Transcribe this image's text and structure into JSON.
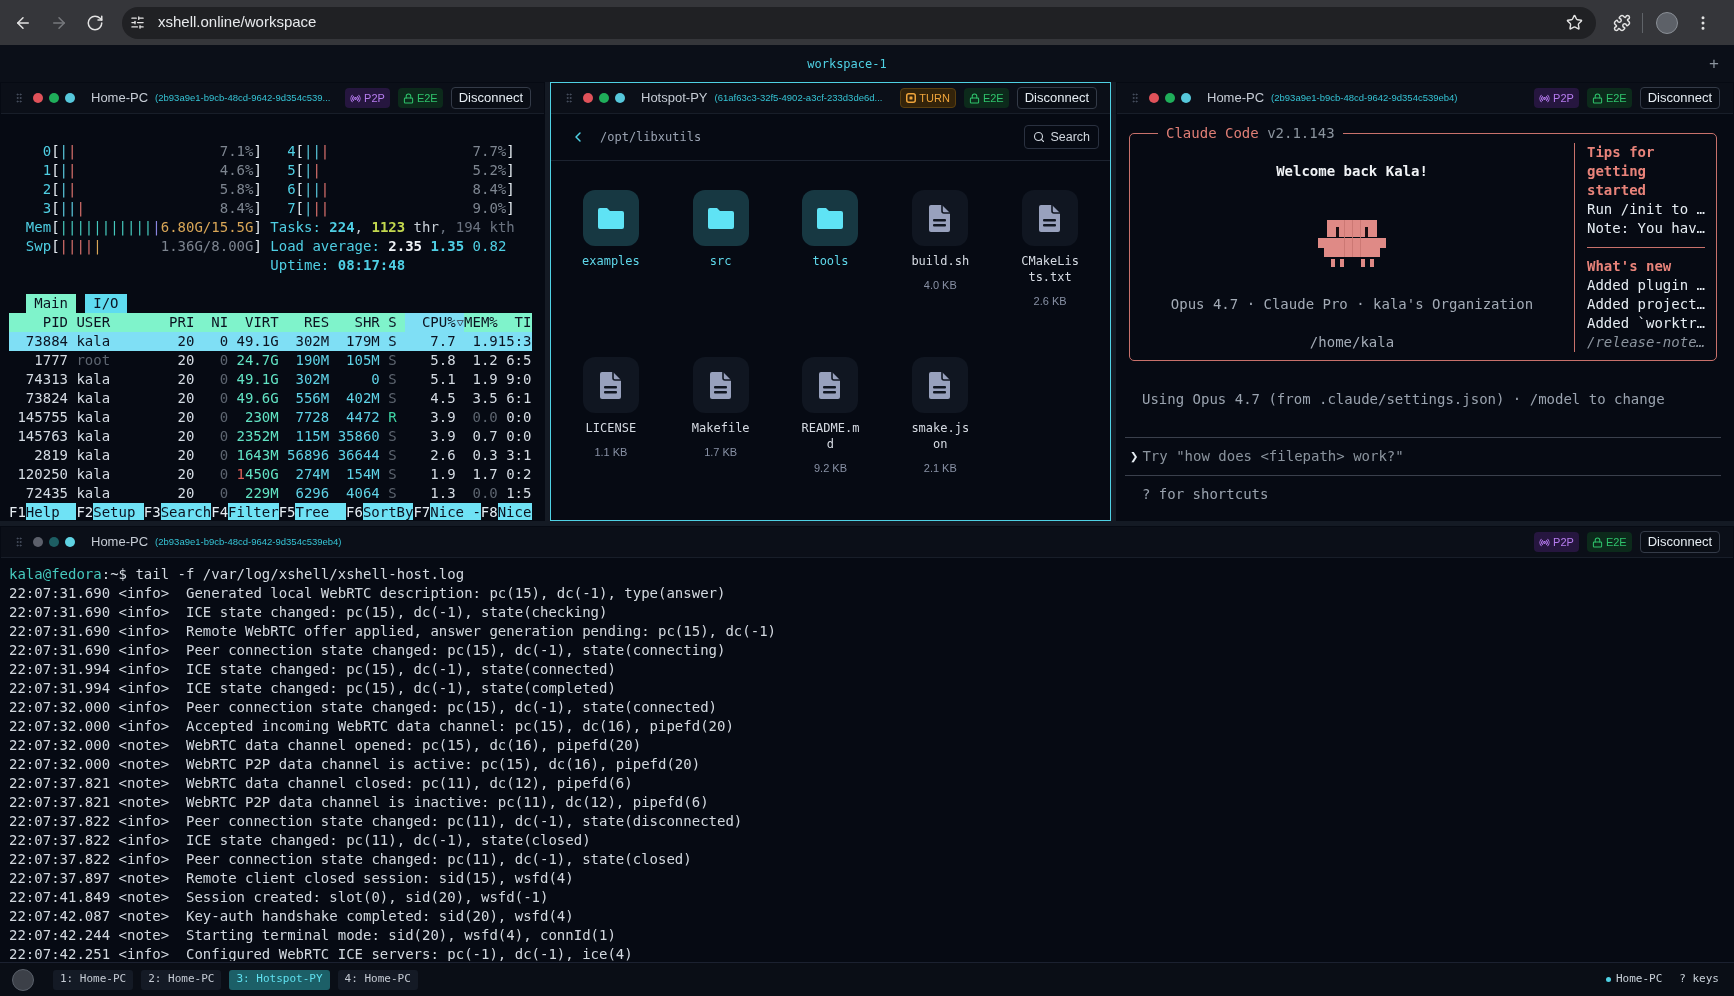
{
  "browser": {
    "nav": [
      {
        "kind": "back",
        "disabled": false
      },
      {
        "kind": "forward",
        "disabled": true
      },
      {
        "kind": "reload",
        "disabled": false
      }
    ],
    "url": "xshell.online/workspace"
  },
  "workspace": {
    "title": "workspace-1",
    "add": "+"
  },
  "panes": [
    {
      "kind": "htop",
      "host": "Home-PC",
      "session": "(2b93a9e1-b9cb-48cd-9642-9d354c539...",
      "focused": false,
      "dots": [
        {
          "color": "#e0525a"
        },
        {
          "color": "#1fae5a"
        },
        {
          "color": "#56c8dc"
        }
      ],
      "badges": [
        {
          "kind": "p2p",
          "label": "P2P"
        },
        {
          "kind": "e2e",
          "label": "E2E"
        }
      ],
      "action": "Disconnect",
      "htop": {
        "cpus": [
          {
            "label": "0",
            "open": "[",
            "bars": [
              {
                "kind": "user",
                "text": "|"
              },
              {
                "kind": "system",
                "text": "|"
              }
            ],
            "reading": "7.1%",
            "close": "]"
          },
          {
            "label": "1",
            "open": "[",
            "bars": [
              {
                "kind": "user",
                "text": "|"
              },
              {
                "kind": "system",
                "text": "|"
              }
            ],
            "reading": "4.6%",
            "close": "]"
          },
          {
            "label": "2",
            "open": "[",
            "bars": [
              {
                "kind": "user",
                "text": "|"
              },
              {
                "kind": "system",
                "text": "|"
              }
            ],
            "reading": "5.8%",
            "close": "]"
          },
          {
            "label": "3",
            "open": "[",
            "bars": [
              {
                "kind": "user",
                "text": "||"
              },
              {
                "kind": "system",
                "text": "|"
              }
            ],
            "reading": "8.4%",
            "close": "]"
          },
          {
            "label": "4",
            "open": "[",
            "bars": [
              {
                "kind": "user",
                "text": "||"
              },
              {
                "kind": "system",
                "text": "|"
              }
            ],
            "reading": "7.7%",
            "close": "]"
          },
          {
            "label": "5",
            "open": "[",
            "bars": [
              {
                "kind": "user",
                "text": "|"
              },
              {
                "kind": "system",
                "text": "|"
              }
            ],
            "reading": "5.2%",
            "close": "]"
          },
          {
            "label": "6",
            "open": "[",
            "bars": [
              {
                "kind": "user",
                "text": "||"
              },
              {
                "kind": "system",
                "text": "|"
              }
            ],
            "reading": "8.4%",
            "close": "]"
          },
          {
            "label": "7",
            "open": "[",
            "bars": [
              {
                "kind": "user",
                "text": "|"
              },
              {
                "kind": "system",
                "text": "||"
              }
            ],
            "reading": "9.0%",
            "close": "]"
          }
        ],
        "memory": {
          "label": "Mem",
          "open": "[",
          "bars": [
            {
              "kind": "used",
              "text": "|||||||||||"
            },
            {
              "kind": "buffers",
              "text": "|"
            }
          ],
          "reading": "6.80G/15.5G",
          "close": "]"
        },
        "swap": {
          "label": "Swp",
          "open": "[",
          "bars": [
            {
              "kind": "system",
              "text": "||||"
            },
            {
              "kind": "cache",
              "text": "|"
            }
          ],
          "reading": "1.36G/8.00G",
          "close": "]"
        },
        "summary": [
          [
            {
              "kind": "label",
              "text": "Tasks: "
            },
            {
              "kind": "value",
              "text": "224"
            },
            {
              "kind": "plain",
              "text": ", "
            },
            {
              "kind": "count",
              "text": "1123"
            },
            {
              "kind": "unit",
              "text": " thr"
            },
            {
              "kind": "dim",
              "text": ", 194 kth"
            }
          ],
          [
            {
              "kind": "label",
              "text": "Load average: "
            },
            {
              "kind": "strong",
              "text": "2.35"
            },
            {
              "kind": "value",
              "text": " 1.35"
            },
            {
              "kind": "label",
              "text": " 0.82"
            }
          ],
          [
            {
              "kind": "label",
              "text": "Uptime: "
            },
            {
              "kind": "value",
              "text": "08:17:48"
            }
          ]
        ],
        "tabs": [
          {
            "label": "Main",
            "selected": true
          },
          {
            "label": "I/O",
            "selected": false
          }
        ],
        "columns": [
          {
            "label": "PID",
            "sorted": false
          },
          {
            "label": "USER",
            "sorted": false
          },
          {
            "label": "PRI",
            "sorted": false
          },
          {
            "label": "NI",
            "sorted": false
          },
          {
            "label": "VIRT",
            "sorted": false
          },
          {
            "label": "RES",
            "sorted": false
          },
          {
            "label": "SHR",
            "sorted": false
          },
          {
            "label": "S",
            "sorted": false
          },
          {
            "label": "CPU%",
            "sorted": true
          },
          {
            "label": "MEM%",
            "sorted": false
          },
          {
            "label": "TI",
            "sorted": false
          }
        ],
        "rows": [
          {
            "selected": true,
            "cells": [
              "73884",
              "kala",
              "20",
              "0",
              "49.1G",
              "302M",
              "179M",
              "S",
              "7.7",
              "1.9",
              "15:3"
            ]
          },
          {
            "selected": false,
            "cells": [
              "1777",
              {
                "text": "root",
                "kind": "dim"
              },
              "20",
              "0",
              "24.7G",
              "190M",
              "105M",
              "S",
              "5.8",
              "1.2",
              "6:5"
            ]
          },
          {
            "selected": false,
            "cells": [
              "74313",
              "kala",
              "20",
              "0",
              "49.1G",
              "302M",
              "0",
              "S",
              "5.1",
              "1.9",
              "9:0"
            ]
          },
          {
            "selected": false,
            "cells": [
              "73824",
              "kala",
              "20",
              "0",
              "49.6G",
              "556M",
              "402M",
              "S",
              "4.5",
              "3.5",
              "6:1"
            ]
          },
          {
            "selected": false,
            "cells": [
              "145755",
              "kala",
              "20",
              "0",
              "230M",
              "7728",
              "4472",
              {
                "text": "R",
                "kind": "running"
              },
              "3.9",
              {
                "text": "0.0",
                "kind": "dim"
              },
              "0:0"
            ]
          },
          {
            "selected": false,
            "cells": [
              "145763",
              "kala",
              "20",
              "0",
              "2352M",
              "115M",
              "35860",
              "S",
              "3.9",
              "0.7",
              "0:0"
            ]
          },
          {
            "selected": false,
            "cells": [
              "2819",
              "kala",
              "20",
              "0",
              "1643M",
              "56896",
              "36644",
              "S",
              "2.6",
              "0.3",
              "3:1"
            ]
          },
          {
            "selected": false,
            "cells": [
              "120250",
              "kala",
              "20",
              "0",
              {
                "lead": "1",
                "text": "450G"
              },
              "274M",
              "154M",
              "S",
              "1.9",
              "1.7",
              "0:2"
            ]
          },
          {
            "selected": false,
            "cells": [
              "72435",
              "kala",
              "20",
              "0",
              "229M",
              "6296",
              "4064",
              "S",
              "1.3",
              {
                "text": "0.0",
                "kind": "dim"
              },
              "1:5"
            ]
          }
        ],
        "keys": [
          {
            "key": "F1",
            "label": "Help"
          },
          {
            "key": "F2",
            "label": "Setup"
          },
          {
            "key": "F3",
            "label": "Search"
          },
          {
            "key": "F4",
            "label": "Filter"
          },
          {
            "key": "F5",
            "label": "Tree"
          },
          {
            "key": "F6",
            "label": "SortBy"
          },
          {
            "key": "F7",
            "label": "Nice -"
          },
          {
            "key": "F8",
            "label": "Nice"
          }
        ]
      }
    },
    {
      "kind": "files",
      "host": "Hotspot-PY",
      "session": "(61af63c3-32f5-4902-a3cf-233d3de6d...",
      "focused": true,
      "dots": [
        {
          "color": "#e0525a"
        },
        {
          "color": "#1fae5a"
        },
        {
          "color": "#56c8dc"
        }
      ],
      "badges": [
        {
          "kind": "turn",
          "label": "TURN"
        },
        {
          "kind": "e2e",
          "label": "E2E"
        }
      ],
      "action": "Disconnect",
      "files": {
        "path": "/opt/libxutils",
        "search": "Search",
        "items": [
          {
            "kind": "folder",
            "name": "examples"
          },
          {
            "kind": "folder",
            "name": "src"
          },
          {
            "kind": "folder",
            "name": "tools"
          },
          {
            "kind": "file",
            "name": "build.sh",
            "size": "4.0 KB"
          },
          {
            "kind": "file",
            "name": "CMakeLists.txt",
            "size": "2.6 KB"
          },
          {
            "kind": "file",
            "name": "LICENSE",
            "size": "1.1 KB"
          },
          {
            "kind": "file",
            "name": "Makefile",
            "size": "1.7 KB"
          },
          {
            "kind": "file",
            "name": "README.md",
            "size": "9.2 KB"
          },
          {
            "kind": "file",
            "name": "smake.json",
            "size": "2.1 KB"
          }
        ]
      }
    },
    {
      "kind": "claude",
      "host": "Home-PC",
      "session": "(2b93a9e1-b9cb-48cd-9642-9d354c539eb4)",
      "focused": false,
      "dots": [
        {
          "color": "#e0525a"
        },
        {
          "color": "#1fae5a"
        },
        {
          "color": "#56c8dc"
        }
      ],
      "badges": [
        {
          "kind": "p2p",
          "label": "P2P"
        },
        {
          "kind": "e2e",
          "label": "E2E"
        }
      ],
      "action": "Disconnect",
      "claude": {
        "title": "Claude Code",
        "version": "v2.1.143",
        "welcome": "Welcome back Kala!",
        "plan": "Opus 4.7 · Claude Pro · kala's Organization",
        "cwd": "/home/kala",
        "sections": [
          {
            "heading": "Tips for getting started",
            "lines": [
              {
                "kind": "item",
                "text": "Run /init to …"
              },
              {
                "kind": "item",
                "text": "Note: You hav…"
              }
            ]
          },
          {
            "heading": "What's new",
            "lines": [
              {
                "kind": "item",
                "text": "Added plugin …"
              },
              {
                "kind": "item",
                "text": "Added project…"
              },
              {
                "kind": "item",
                "text": "Added `worktr…"
              },
              {
                "kind": "link",
                "text": "/release-note…"
              }
            ]
          }
        ],
        "model_note": "Using Opus 4.7 (from .claude/settings.json) · /model to change",
        "prompt": {
          "caret": "❯",
          "placeholder": "Try \"how does <filepath> work?\""
        },
        "hint": "? for shortcuts"
      }
    },
    {
      "kind": "log",
      "host": "Home-PC",
      "session": "(2b93a9e1-b9cb-48cd-9642-9d354c539eb4)",
      "focused": false,
      "dots": [
        {
          "color": "#5c606b"
        },
        {
          "color": "#1d5e63"
        },
        {
          "color": "#5fd3e3"
        }
      ],
      "badges": [
        {
          "kind": "p2p",
          "label": "P2P"
        },
        {
          "kind": "e2e",
          "label": "E2E"
        }
      ],
      "action": "Disconnect",
      "log": {
        "prompt": {
          "user": "kala@fedora",
          "path": ":~$",
          "command": "tail -f /var/log/xshell/xshell-host.log"
        },
        "lines": [
          "22:07:31.690 <info>  Generated local WebRTC description: pc(15), dc(-1), type(answer)",
          "22:07:31.690 <info>  ICE state changed: pc(15), dc(-1), state(checking)",
          "22:07:31.690 <info>  Remote WebRTC offer applied, answer generation pending: pc(15), dc(-1)",
          "22:07:31.690 <info>  Peer connection state changed: pc(15), dc(-1), state(connecting)",
          "22:07:31.994 <info>  ICE state changed: pc(15), dc(-1), state(connected)",
          "22:07:31.994 <info>  ICE state changed: pc(15), dc(-1), state(completed)",
          "22:07:32.000 <info>  Peer connection state changed: pc(15), dc(-1), state(connected)",
          "22:07:32.000 <info>  Accepted incoming WebRTC data channel: pc(15), dc(16), pipefd(20)",
          "22:07:32.000 <note>  WebRTC data channel opened: pc(15), dc(16), pipefd(20)",
          "22:07:32.000 <note>  WebRTC P2P data channel is active: pc(15), dc(16), pipefd(20)",
          "22:07:37.821 <note>  WebRTC data channel closed: pc(11), dc(12), pipefd(6)",
          "22:07:37.821 <note>  WebRTC P2P data channel is inactive: pc(11), dc(12), pipefd(6)",
          "22:07:37.822 <info>  Peer connection state changed: pc(11), dc(-1), state(disconnected)",
          "22:07:37.822 <info>  ICE state changed: pc(11), dc(-1), state(closed)",
          "22:07:37.822 <info>  Peer connection state changed: pc(11), dc(-1), state(closed)",
          "22:07:37.897 <note>  Remote client closed session: sid(15), wsfd(4)",
          "22:07:41.849 <note>  Session created: slot(0), sid(20), wsfd(-1)",
          "22:07:42.087 <note>  Key-auth handshake completed: sid(20), wsfd(4)",
          "22:07:42.244 <note>  Starting terminal mode: sid(20), wsfd(4), connId(1)",
          "22:07:42.251 <info>  Configured WebRTC ICE servers: pc(-1), dc(-1), ice(4)"
        ]
      }
    }
  ],
  "taskbar": {
    "tabs": [
      {
        "label": "1: Home-PC",
        "selected": false
      },
      {
        "label": "2: Home-PC",
        "selected": false
      },
      {
        "label": "3: Hotspot-PY",
        "selected": true
      },
      {
        "label": "4: Home-PC",
        "selected": false
      }
    ],
    "status": {
      "host": "Home-PC",
      "hint": "? keys"
    }
  }
}
